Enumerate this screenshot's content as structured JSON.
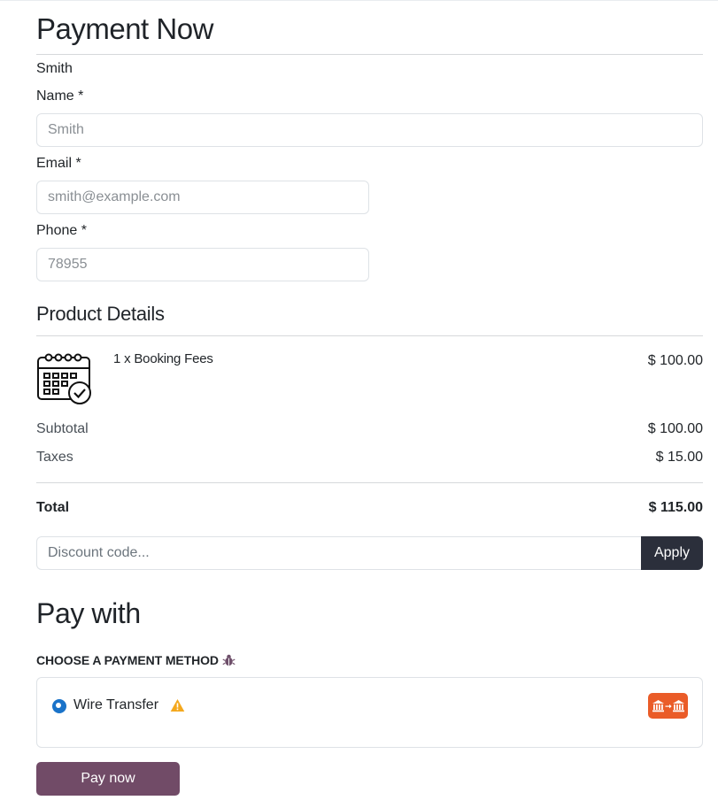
{
  "page": {
    "title": "Payment Now",
    "customer_name": "Smith"
  },
  "form": {
    "name_label": "Name *",
    "name_placeholder": "Smith",
    "email_label": "Email *",
    "email_placeholder": "smith@example.com",
    "phone_label": "Phone *",
    "phone_placeholder": "78955"
  },
  "product_details": {
    "heading": "Product Details",
    "items": [
      {
        "name": "1 x Booking Fees",
        "price": "$ 100.00",
        "icon": "calendar-check-icon"
      }
    ],
    "subtotal_label": "Subtotal",
    "subtotal_value": "$ 100.00",
    "taxes_label": "Taxes",
    "taxes_value": "$ 15.00",
    "total_label": "Total",
    "total_value": "$ 115.00"
  },
  "discount": {
    "placeholder": "Discount code...",
    "apply_label": "Apply"
  },
  "payment": {
    "heading": "Pay with",
    "choose_label": "CHOOSE A PAYMENT METHOD",
    "choose_icon": "bug-icon",
    "methods": [
      {
        "label": "Wire Transfer",
        "selected": true,
        "warning_icon": "warning-icon",
        "badge_icon": "bank-transfer-icon"
      }
    ],
    "pay_button_label": "Pay now"
  },
  "colors": {
    "apply_bg": "#2b2f3b",
    "pay_button_bg": "#714b67",
    "radio_selected": "#1a73c9",
    "warning": "#f4a81d",
    "wire_badge_bg": "#ea5c28"
  }
}
